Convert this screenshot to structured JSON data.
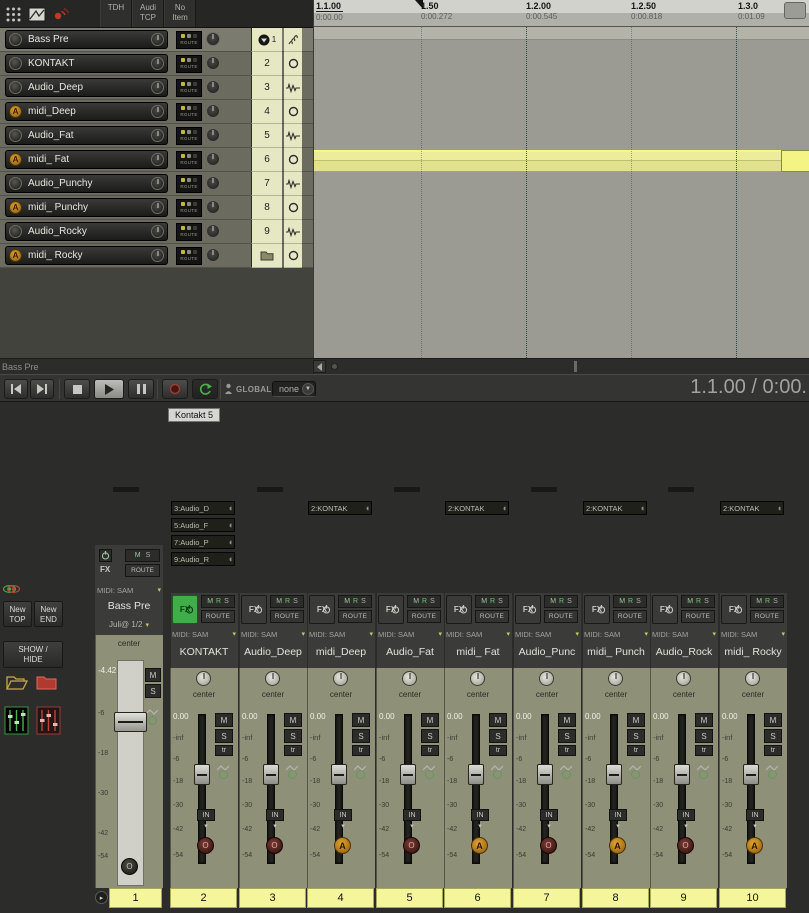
{
  "tcp": {
    "toolbar": {
      "buttons": [
        [
          "TDH",
          ""
        ],
        [
          "Audi",
          "TCP"
        ],
        [
          "No",
          "Item"
        ]
      ]
    },
    "route_label": "ROUTE",
    "bottom_label": "Bass Pre",
    "tracks": [
      {
        "name": "Bass Pre",
        "num": "1",
        "arm": "",
        "kind": "audio",
        "media_icon": "spring",
        "folder": "parent"
      },
      {
        "name": "KONTAKT",
        "num": "2",
        "arm": "",
        "kind": "audio",
        "media_icon": "midi"
      },
      {
        "name": "Audio_Deep",
        "num": "3",
        "arm": "",
        "kind": "audio",
        "media_icon": "wave"
      },
      {
        "name": "midi_Deep",
        "num": "4",
        "arm": "A",
        "kind": "midi",
        "media_icon": "midi"
      },
      {
        "name": "Audio_Fat",
        "num": "5",
        "arm": "",
        "kind": "audio",
        "media_icon": "wave"
      },
      {
        "name": "midi_ Fat",
        "num": "6",
        "arm": "A",
        "kind": "midi",
        "media_icon": "midi"
      },
      {
        "name": "Audio_Punchy",
        "num": "7",
        "arm": "",
        "kind": "audio",
        "media_icon": "wave"
      },
      {
        "name": "midi_ Punchy",
        "num": "8",
        "arm": "A",
        "kind": "midi",
        "media_icon": "midi"
      },
      {
        "name": "Audio_Rocky",
        "num": "9",
        "arm": "",
        "kind": "audio",
        "media_icon": "wave"
      },
      {
        "name": "midi_ Rocky",
        "num": "",
        "arm": "A",
        "kind": "midi",
        "media_icon": "midi",
        "folder": "end"
      }
    ]
  },
  "timeline": {
    "marks": [
      {
        "beat": "1.1.00",
        "time": "0:00.00"
      },
      {
        "beat": "1.50",
        "time": "0:00.272"
      },
      {
        "beat": "1.2.00",
        "time": "0:00.545"
      },
      {
        "beat": "1.2.50",
        "time": "0:00.818"
      },
      {
        "beat": "1.3.0",
        "time": "0:01.09"
      }
    ]
  },
  "transport": {
    "global_label": "GLOBAL",
    "global_value": "none",
    "time_display": "1.1.00 / 0:00."
  },
  "tooltip": "Kontakt 5",
  "sidebar": {
    "new_top": [
      "New",
      "TOP"
    ],
    "new_end": [
      "New",
      "END"
    ],
    "show_hide": [
      "SHOW /",
      "HIDE"
    ]
  },
  "mixer": {
    "labels": {
      "fx": "FX",
      "m": "M",
      "r": "R",
      "s": "S",
      "route": "ROUTE",
      "midi_input": "MIDI: SAM",
      "pan": "center",
      "inf": "-inf",
      "tr": "tr",
      "input": "IN",
      "scale": [
        "-6",
        "-18",
        "-30",
        "-42",
        "-54"
      ]
    },
    "master": {
      "name": "Bass Pre",
      "output": "Juli@ 1/2",
      "midi_input": "MIDI: SAM",
      "pan": "center",
      "vol": "-4.42",
      "rec": "O",
      "num": "1"
    },
    "channels": [
      {
        "name": "KONTAKT",
        "num": "2",
        "vol": "0.00",
        "rec": "O",
        "fx_on": true,
        "sends": [
          "3:Audio_D",
          "5:Audio_F",
          "7:Audio_P",
          "9:Audio_R"
        ]
      },
      {
        "name": "Audio_Deep",
        "num": "3",
        "vol": "0.00",
        "rec": "O",
        "sends": []
      },
      {
        "name": "midi_Deep",
        "num": "4",
        "vol": "0.00",
        "rec": "A",
        "sends": [
          "2:KONTAK"
        ]
      },
      {
        "name": "Audio_Fat",
        "num": "5",
        "vol": "0.00",
        "rec": "O",
        "sends": []
      },
      {
        "name": "midi_ Fat",
        "num": "6",
        "vol": "0.00",
        "rec": "A",
        "sends": [
          "2:KONTAK"
        ]
      },
      {
        "name": "Audio_Punc",
        "num": "7",
        "vol": "0.00",
        "rec": "O",
        "sends": []
      },
      {
        "name": "midi_ Punch",
        "num": "8",
        "vol": "0.00",
        "rec": "A",
        "sends": [
          "2:KONTAK"
        ]
      },
      {
        "name": "Audio_Rock",
        "num": "9",
        "vol": "0.00",
        "rec": "O",
        "sends": []
      },
      {
        "name": "midi_ Rocky",
        "num": "10",
        "vol": "0.00",
        "rec": "A",
        "sends": [
          "2:KONTAK"
        ]
      }
    ]
  },
  "colors": {
    "fx_green": "#3fae49",
    "rec_amber": "#c8861e",
    "item_yellow": "#ecec9c",
    "number_yellow": "#f5f59c"
  }
}
